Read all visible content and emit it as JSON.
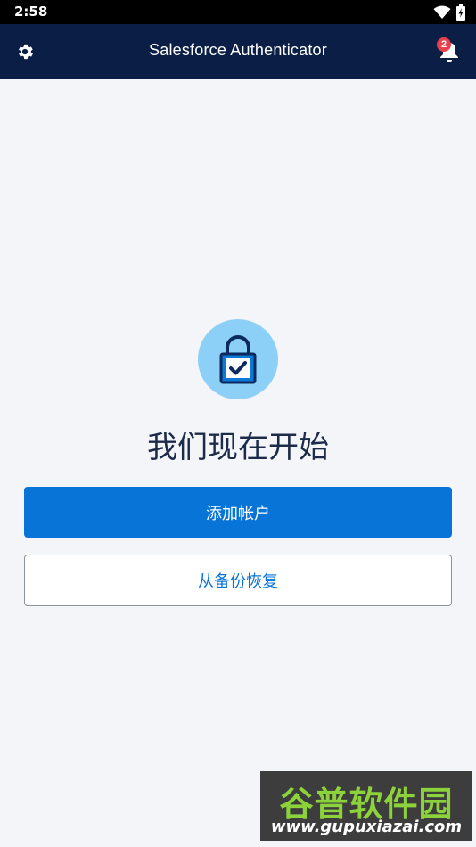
{
  "status_bar": {
    "time": "2:58",
    "icons": [
      "wifi-icon",
      "battery-charging-icon"
    ]
  },
  "app_bar": {
    "title": "Salesforce Authenticator",
    "settings_icon": "gear-icon",
    "notifications_icon": "bell-icon",
    "notification_count": "2"
  },
  "main": {
    "illustration_icon": "lock-check-icon",
    "headline": "我们现在开始",
    "add_account_label": "添加帐户",
    "restore_backup_label": "从备份恢复"
  },
  "watermark": {
    "text": "谷普软件园",
    "url": "www.gupuxiazai.com"
  },
  "colors": {
    "app_bar_bg": "#0b1f46",
    "primary": "#0874d8",
    "badge": "#e8414b",
    "lock_circle": "#8dd0f7",
    "page_bg": "#f3f5f9"
  }
}
